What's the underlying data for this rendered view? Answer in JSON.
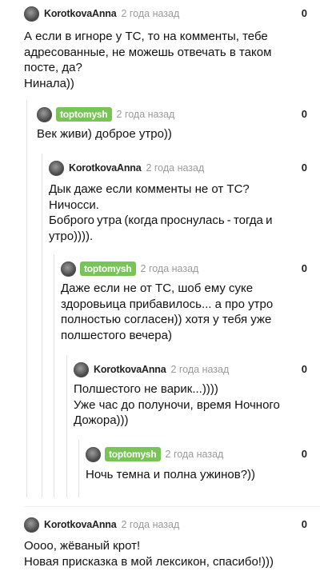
{
  "comments": [
    {
      "author": "KorotkovaAnna",
      "time": "2 года назад",
      "rating": "0",
      "text": "А если в игноре у ТС, то на комменты, тебе адресованные, не можешь отвечать в таком посте, да?\nНинала))"
    },
    {
      "author": "toptomysh",
      "time": "2 года назад",
      "rating": "0",
      "text": "Век живи) доброе утро))"
    },
    {
      "author": "KorotkovaAnna",
      "time": "2 года назад",
      "rating": "0",
      "text": "Дык даже если комменты не от ТС?\nНичосси.\nБоброго утра (когда проснулась - тогда и утро)))).",
      "text_lines": [
        "Дык даже если комменты не от ТС?",
        "Ничосси.",
        "Боброго утра (когда проснулась - тогда и",
        "утро))))."
      ]
    },
    {
      "author": "toptomysh",
      "time": "2 года назад",
      "rating": "0",
      "text": "Даже если не от ТС, шоб ему суке здоровьица прибавилось... а про утро полностью согласен)) хотя у тебя уже полшестого вечера)"
    },
    {
      "author": "KorotkovaAnna",
      "time": "2 года назад",
      "rating": "0",
      "text": "Полшестого не варик...))))\nУже час до полуночи, время Ночного Дожора)))"
    },
    {
      "author": "toptomysh",
      "time": "2 года назад",
      "rating": "0",
      "text": "Ночь темна и полна ужинов?))"
    },
    {
      "author": "KorotkovaAnna",
      "time": "2 года назад",
      "rating": "0",
      "text": "Оооо, жёваный крот!\nНовая присказка в мой лексикон, спасибо!)))"
    }
  ]
}
